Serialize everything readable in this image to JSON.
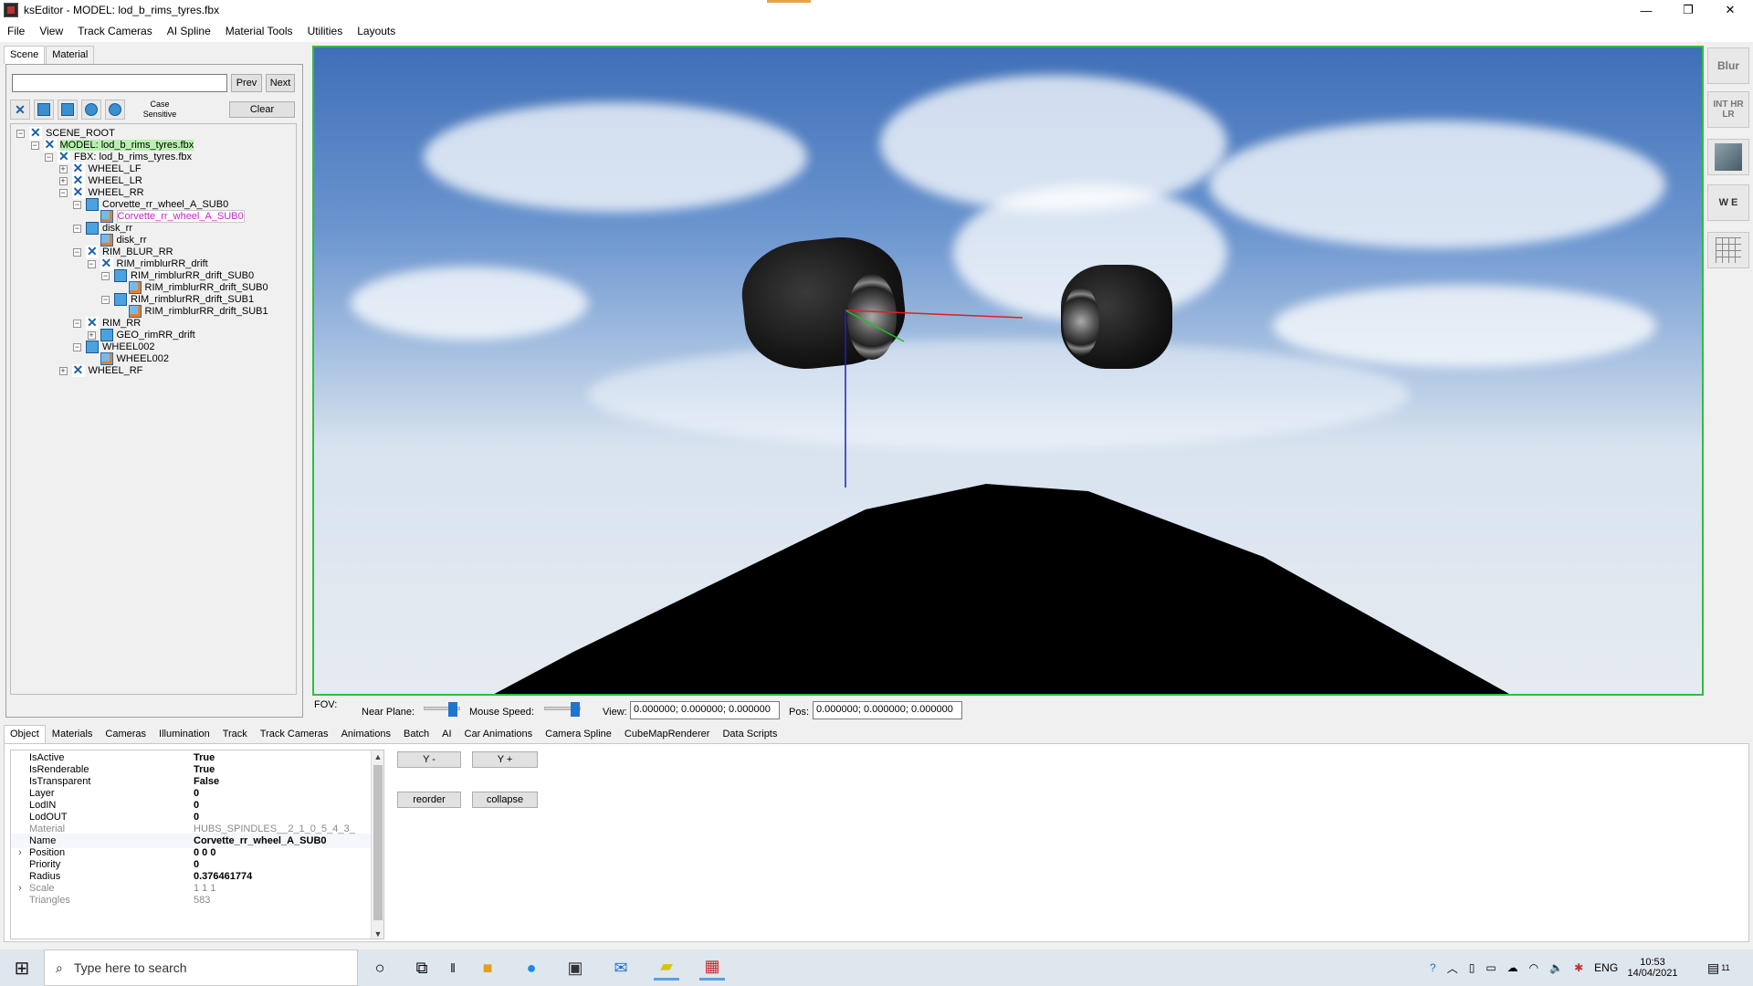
{
  "window": {
    "title": "ksEditor - MODEL: lod_b_rims_tyres.fbx",
    "minimize": "—",
    "restore": "❐",
    "close": "✕"
  },
  "menu": [
    "File",
    "View",
    "Track Cameras",
    "AI Spline",
    "Material Tools",
    "Utilities",
    "Layouts"
  ],
  "left_panel": {
    "tabs": [
      "Scene",
      "Material"
    ],
    "search_value": "",
    "prev_label": "Prev",
    "next_label": "Next",
    "case_label": "Case Sensitive",
    "clear_label": "Clear"
  },
  "tree": [
    {
      "label": "SCENE_ROOT",
      "depth": 0,
      "exp": "-",
      "icon": "star"
    },
    {
      "label": "MODEL: lod_b_rims_tyres.fbx",
      "depth": 1,
      "exp": "-",
      "icon": "star",
      "hl": "green"
    },
    {
      "label": "FBX: lod_b_rims_tyres.fbx",
      "depth": 2,
      "exp": "-",
      "icon": "star"
    },
    {
      "label": "WHEEL_LF",
      "depth": 3,
      "exp": "+",
      "icon": "star"
    },
    {
      "label": "WHEEL_LR",
      "depth": 3,
      "exp": "+",
      "icon": "star"
    },
    {
      "label": "WHEEL_RR",
      "depth": 3,
      "exp": "-",
      "icon": "star"
    },
    {
      "label": "Corvette_rr_wheel_A_SUB0",
      "depth": 4,
      "exp": "-",
      "icon": "geo"
    },
    {
      "label": "Corvette_rr_wheel_A_SUB0",
      "depth": 5,
      "exp": "",
      "icon": "mesh",
      "hl": "pink"
    },
    {
      "label": "disk_rr",
      "depth": 4,
      "exp": "-",
      "icon": "geo"
    },
    {
      "label": "disk_rr",
      "depth": 5,
      "exp": "",
      "icon": "mesh"
    },
    {
      "label": "RIM_BLUR_RR",
      "depth": 4,
      "exp": "-",
      "icon": "star"
    },
    {
      "label": "RIM_rimblurRR_drift",
      "depth": 5,
      "exp": "-",
      "icon": "star"
    },
    {
      "label": "RIM_rimblurRR_drift_SUB0",
      "depth": 6,
      "exp": "-",
      "icon": "geo"
    },
    {
      "label": "RIM_rimblurRR_drift_SUB0",
      "depth": 7,
      "exp": "",
      "icon": "mesh"
    },
    {
      "label": "RIM_rimblurRR_drift_SUB1",
      "depth": 6,
      "exp": "-",
      "icon": "geo"
    },
    {
      "label": "RIM_rimblurRR_drift_SUB1",
      "depth": 7,
      "exp": "",
      "icon": "mesh"
    },
    {
      "label": "RIM_RR",
      "depth": 4,
      "exp": "-",
      "icon": "star"
    },
    {
      "label": "GEO_rimRR_drift",
      "depth": 5,
      "exp": "+",
      "icon": "geo"
    },
    {
      "label": "WHEEL002",
      "depth": 4,
      "exp": "-",
      "icon": "geo"
    },
    {
      "label": "WHEEL002",
      "depth": 5,
      "exp": "",
      "icon": "mesh"
    },
    {
      "label": "WHEEL_RF",
      "depth": 3,
      "exp": "+",
      "icon": "star"
    }
  ],
  "viewport_bar": {
    "fov_label": "FOV:",
    "near_plane_label": "Near Plane:",
    "mouse_speed_label": "Mouse Speed:",
    "view_label": "View:",
    "view_value": "0.000000; 0.000000; 0.000000",
    "pos_label": "Pos:",
    "pos_value": "0.000000; 0.000000; 0.000000"
  },
  "bottom_tabs": [
    "Object",
    "Materials",
    "Cameras",
    "Illumination",
    "Track",
    "Track Cameras",
    "Animations",
    "Batch",
    "AI",
    "Car Animations",
    "Camera Spline",
    "CubeMapRenderer",
    "Data Scripts"
  ],
  "properties": [
    {
      "name": "IsActive",
      "value": "True",
      "exp": ""
    },
    {
      "name": "IsRenderable",
      "value": "True",
      "exp": ""
    },
    {
      "name": "IsTransparent",
      "value": "False",
      "exp": ""
    },
    {
      "name": "Layer",
      "value": "0",
      "exp": ""
    },
    {
      "name": "LodIN",
      "value": "0",
      "exp": ""
    },
    {
      "name": "LodOUT",
      "value": "0",
      "exp": ""
    },
    {
      "name": "Material",
      "value": "HUBS_SPINDLES__2_1_0_5_4_3_",
      "exp": "",
      "dim": true
    },
    {
      "name": "Name",
      "value": "Corvette_rr_wheel_A_SUB0",
      "exp": "",
      "sel": true
    },
    {
      "name": "Position",
      "value": "0 0 0",
      "exp": "›"
    },
    {
      "name": "Priority",
      "value": "0",
      "exp": ""
    },
    {
      "name": "Radius",
      "value": "0.376461774",
      "exp": ""
    },
    {
      "name": "Scale",
      "value": "1 1 1",
      "exp": "›",
      "dim": true
    },
    {
      "name": "Triangles",
      "value": "583",
      "exp": "",
      "dim": true
    }
  ],
  "object_buttons": {
    "y_minus": "Y -",
    "y_plus": "Y +",
    "reorder": "reorder",
    "collapse": "collapse"
  },
  "right_tools": [
    {
      "label": "Blur",
      "icon": "blur-icon"
    },
    {
      "label": "INT HR LR",
      "icon": "int-icon"
    },
    {
      "label": "",
      "icon": "glass-icon"
    },
    {
      "label": "W E",
      "icon": "we-icon"
    },
    {
      "label": "",
      "icon": "grid-icon"
    }
  ],
  "taskbar": {
    "search_placeholder": "Type here to search",
    "lang": "ENG",
    "time": "10:53",
    "date": "14/04/2021",
    "notif_count": "11"
  },
  "colors": {
    "viewport_border": "#2fbf3f",
    "tree_highlight": "#b9f0b0",
    "selected_mesh_text": "#d020d0",
    "axis_x": "#e02020",
    "axis_y": "#20c020",
    "axis_z": "#2020c0"
  }
}
